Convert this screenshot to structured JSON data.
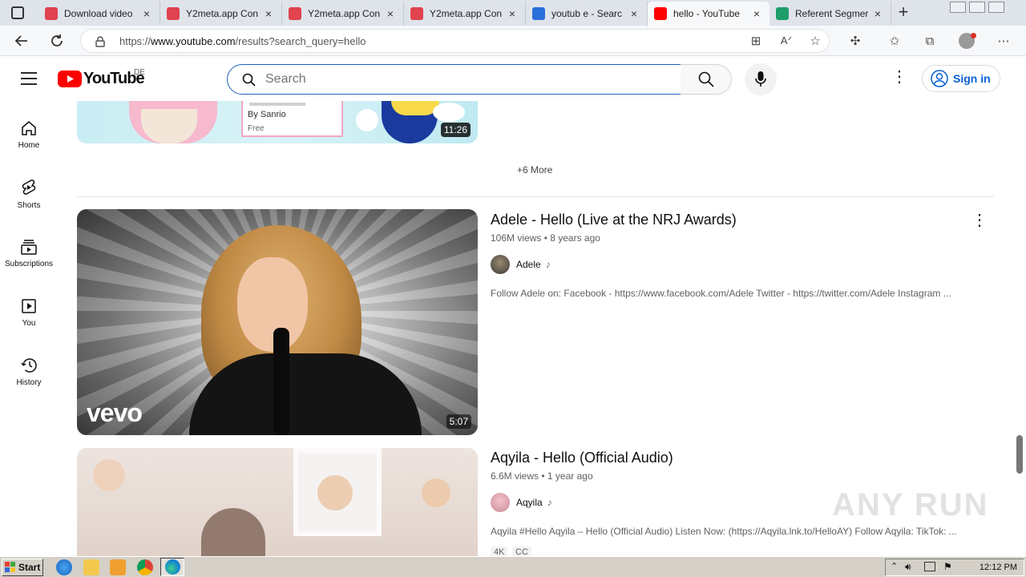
{
  "browser": {
    "tabs": [
      {
        "title": "Download video",
        "icon_color": "#e0424e",
        "active": false
      },
      {
        "title": "Y2meta.app Con",
        "icon_color": "#e0424e",
        "active": false
      },
      {
        "title": "Y2meta.app Con",
        "icon_color": "#e0424e",
        "active": false
      },
      {
        "title": "Y2meta.app Con",
        "icon_color": "#e0424e",
        "active": false
      },
      {
        "title": "youtub e - Searc",
        "icon_color": "#2a6fdb",
        "active": false
      },
      {
        "title": "hello - YouTube",
        "icon_color": "#ff0000",
        "active": true
      },
      {
        "title": "Referent Segmer",
        "icon_color": "#1e9e6a",
        "active": false
      }
    ],
    "url_prefix": "https://",
    "url_host": "www.youtube.com",
    "url_path": "/results?search_query=hello"
  },
  "youtube": {
    "logo_text": "YouTube",
    "region": "DE",
    "search_placeholder": "Search",
    "signin_label": "Sign in",
    "sidebar": [
      {
        "label": "Home",
        "icon": "home-icon"
      },
      {
        "label": "Shorts",
        "icon": "shorts-icon"
      },
      {
        "label": "Subscriptions",
        "icon": "subscriptions-icon"
      },
      {
        "label": "You",
        "icon": "you-icon"
      },
      {
        "label": "History",
        "icon": "history-icon"
      }
    ],
    "top_card": {
      "author_prefix": "By",
      "author": "Sanrio",
      "price": "Free",
      "duration": "11:26"
    },
    "more_label": "+6 More",
    "videos": [
      {
        "title": "Adele - Hello (Live at the NRJ Awards)",
        "views": "106M views",
        "age": "8 years ago",
        "channel": "Adele",
        "description": "Follow Adele on: Facebook - https://www.facebook.com/Adele Twitter - https://twitter.com/Adele Instagram ...",
        "duration": "5:07",
        "thumb_brand": "vevo"
      },
      {
        "title": "Aqyila - Hello (Official Audio)",
        "views": "6.6M views",
        "age": "1 year ago",
        "channel": "Aqyila",
        "description": "Aqyila #Hello Aqyila – Hello (Official Audio) Listen Now: (https://Aqyila.lnk.to/HelloAY) Follow Aqyila: TikTok: ...",
        "badges": [
          "4K",
          "CC"
        ]
      }
    ]
  },
  "taskbar": {
    "start_label": "Start",
    "clock": "12:12 PM"
  },
  "watermark": "ANY RUN"
}
